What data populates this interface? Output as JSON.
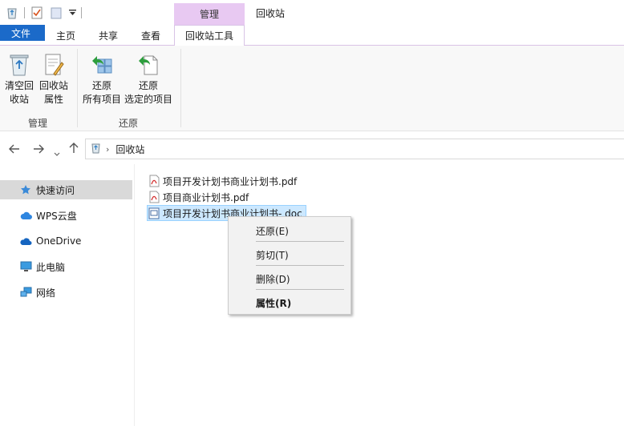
{
  "qat": {
    "icons": [
      "recycle-bin-icon",
      "properties-icon",
      "new-folder-icon",
      "customize-qat-icon"
    ]
  },
  "context_tab_header": "管理",
  "window_title": "回收站",
  "tabs": {
    "file": "文件",
    "home": "主页",
    "share": "共享",
    "view": "查看",
    "tools": "回收站工具"
  },
  "ribbon": {
    "empty_bin": {
      "line1": "清空回",
      "line2": "收站"
    },
    "bin_props": {
      "line1": "回收站",
      "line2": "属性"
    },
    "group_manage": "管理",
    "restore_all": {
      "line1": "还原",
      "line2": "所有项目"
    },
    "restore_selected": {
      "line1": "还原",
      "line2": "选定的项目"
    },
    "group_restore": "还原"
  },
  "address": {
    "path": "回收站"
  },
  "nav_items": [
    {
      "label": "快速访问",
      "icon": "star-icon",
      "selected": true
    },
    {
      "label": "WPS云盘",
      "icon": "cloud-icon"
    },
    {
      "label": "OneDrive",
      "icon": "onedrive-icon"
    },
    {
      "label": "此电脑",
      "icon": "computer-icon"
    },
    {
      "label": "网络",
      "icon": "network-icon"
    }
  ],
  "files": [
    {
      "name": "项目开发计划书商业计划书.pdf",
      "icon": "pdf-file-icon"
    },
    {
      "name": "项目商业计划书.pdf",
      "icon": "pdf-file-icon"
    },
    {
      "name": "项目开发计划书商业计划书- doc",
      "icon": "doc-file-icon",
      "selected": true
    }
  ],
  "context_menu": {
    "restore": "还原(E)",
    "cut": "剪切(T)",
    "delete": "删除(D)",
    "properties": "属性(R)"
  },
  "colors": {
    "file_tab": "#1b6ac9",
    "context_header": "#e8c9f2",
    "selection": "#cce8ff"
  }
}
